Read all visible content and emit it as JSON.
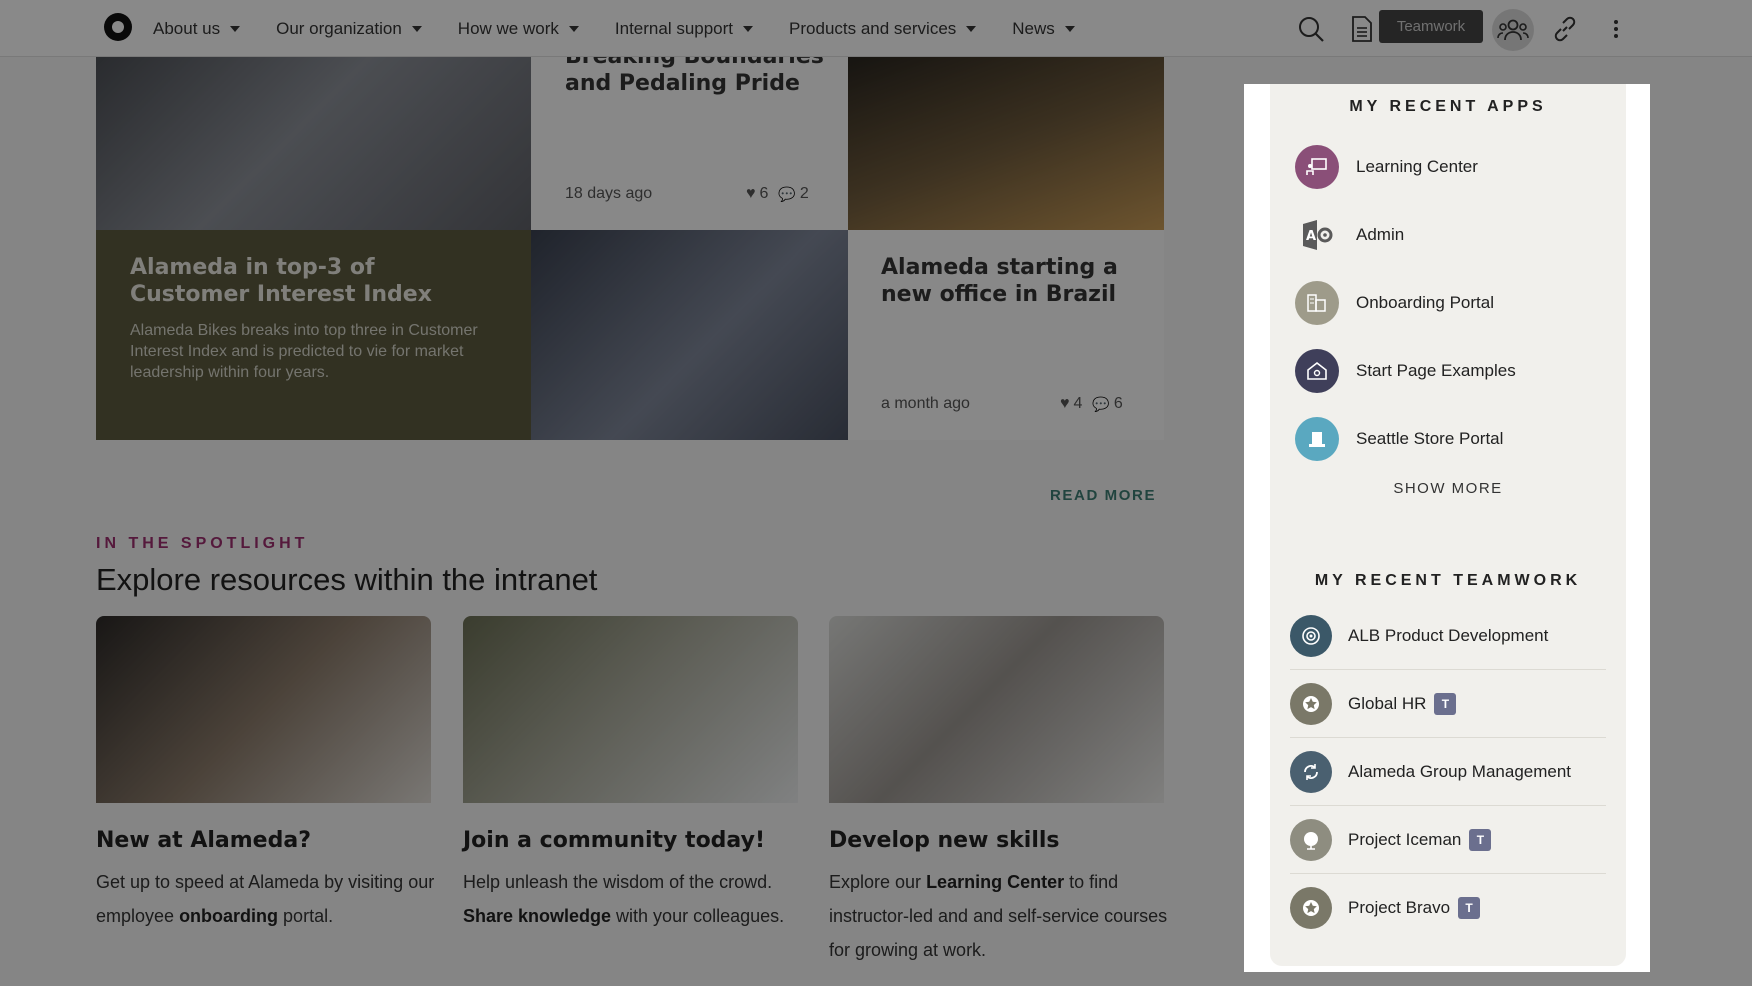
{
  "nav": {
    "items": [
      {
        "label": "About us"
      },
      {
        "label": "Our organization"
      },
      {
        "label": "How we work"
      },
      {
        "label": "Internal support"
      },
      {
        "label": "Products and services"
      },
      {
        "label": "News"
      }
    ],
    "tooltip": "Teamwork",
    "icons": [
      "search-icon",
      "document-icon",
      "teamwork-icon",
      "link-icon",
      "more-icon"
    ]
  },
  "news": {
    "tile1": {
      "title": "Breaking Boundaries and Pedaling Pride",
      "time": "18 days ago",
      "likes": "6",
      "comments": "2"
    },
    "tile2": {
      "title": "Alameda in top-3 of Customer Interest Index",
      "desc": "Alameda Bikes breaks into top three in Customer Interest Index and is predicted to vie for market leadership within four years."
    },
    "tile3": {
      "title": "Alameda starting a new office in Brazil",
      "time": "a month ago",
      "likes": "4",
      "comments": "6"
    },
    "read_more": "READ MORE"
  },
  "spotlight": {
    "label": "IN THE SPOTLIGHT",
    "title": "Explore resources within the intranet",
    "cards": [
      {
        "title": "New at Alameda?",
        "text1": "Get up to speed at Alameda by visiting our employee ",
        "bold": "onboarding",
        "text2": " portal."
      },
      {
        "title": "Join a community today!",
        "text1": "Help unleash the wisdom of the crowd. ",
        "bold": "Share knowledge",
        "text2": " with your colleagues."
      },
      {
        "title": "Develop new skills",
        "text1": "Explore our ",
        "bold": "Learning Center",
        "text2": " to find instructor-led and and self-service courses for growing at work."
      }
    ]
  },
  "panel": {
    "apps_heading": "MY RECENT APPS",
    "apps": [
      {
        "label": "Learning Center",
        "icon": "learning-icon",
        "color": "#8a4f78"
      },
      {
        "label": "Admin",
        "icon": "admin-icon",
        "color": "#f1f0ec"
      },
      {
        "label": "Onboarding Portal",
        "icon": "building-icon",
        "color": "#9e9b8a"
      },
      {
        "label": "Start Page Examples",
        "icon": "home-icon",
        "color": "#3f3f5a"
      },
      {
        "label": "Seattle Store Portal",
        "icon": "store-icon",
        "color": "#5aa8c0"
      }
    ],
    "show_more": "SHOW MORE",
    "teamwork_heading": "MY RECENT TEAMWORK",
    "teamwork": [
      {
        "label": "ALB Product Development",
        "icon": "target-icon",
        "color": "#3b5868",
        "teams": false
      },
      {
        "label": "Global HR",
        "icon": "star-icon",
        "color": "#7a7868",
        "teams": true
      },
      {
        "label": "Alameda Group Management",
        "icon": "cycle-icon",
        "color": "#4a6070",
        "teams": false
      },
      {
        "label": "Project Iceman",
        "icon": "globe-icon",
        "color": "#8e8d80",
        "teams": true
      },
      {
        "label": "Project Bravo",
        "icon": "star-icon",
        "color": "#7a7868",
        "teams": true
      }
    ],
    "teams_badge": "T"
  }
}
